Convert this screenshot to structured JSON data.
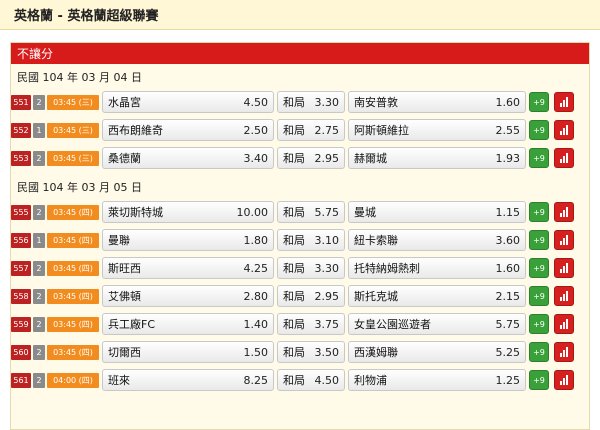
{
  "header": {
    "title": "英格蘭 - 英格蘭超級聯賽"
  },
  "panel": {
    "title": "不讓分"
  },
  "draw_label": "和局",
  "icons": {
    "stats": "bar-chart-icon"
  },
  "colors": {
    "match_no": "#bd2222",
    "time": "#f28c1e",
    "plus": "#3aa13a",
    "stats": "#d62020",
    "panel_head": "#d71a1a"
  },
  "groups": [
    {
      "date": "民國 104 年 03 月 04 日",
      "matches": [
        {
          "no": "551",
          "ch": "2",
          "time": "03:45 (三)",
          "home": "水晶宮",
          "home_odds": "4.50",
          "draw_odds": "3.30",
          "away": "南安普敦",
          "away_odds": "1.60",
          "more": "+9"
        },
        {
          "no": "552",
          "ch": "1",
          "time": "03:45 (三)",
          "home": "西布朗維奇",
          "home_odds": "2.50",
          "draw_odds": "2.75",
          "away": "阿斯頓維拉",
          "away_odds": "2.55",
          "more": "+9"
        },
        {
          "no": "553",
          "ch": "2",
          "time": "03:45 (三)",
          "home": "桑德蘭",
          "home_odds": "3.40",
          "draw_odds": "2.95",
          "away": "赫爾城",
          "away_odds": "1.93",
          "more": "+9"
        }
      ]
    },
    {
      "date": "民國 104 年 03 月 05 日",
      "matches": [
        {
          "no": "555",
          "ch": "2",
          "time": "03:45 (四)",
          "home": "萊切斯特城",
          "home_odds": "10.00",
          "draw_odds": "5.75",
          "away": "曼城",
          "away_odds": "1.15",
          "more": "+9"
        },
        {
          "no": "556",
          "ch": "1",
          "time": "03:45 (四)",
          "home": "曼聯",
          "home_odds": "1.80",
          "draw_odds": "3.10",
          "away": "紐卡索聯",
          "away_odds": "3.60",
          "more": "+9"
        },
        {
          "no": "557",
          "ch": "2",
          "time": "03:45 (四)",
          "home": "斯旺西",
          "home_odds": "4.25",
          "draw_odds": "3.30",
          "away": "托特納姆熱刺",
          "away_odds": "1.60",
          "more": "+9"
        },
        {
          "no": "558",
          "ch": "2",
          "time": "03:45 (四)",
          "home": "艾佛頓",
          "home_odds": "2.80",
          "draw_odds": "2.95",
          "away": "斯托克城",
          "away_odds": "2.15",
          "more": "+9"
        },
        {
          "no": "559",
          "ch": "2",
          "time": "03:45 (四)",
          "home": "兵工廠FC",
          "home_odds": "1.40",
          "draw_odds": "3.75",
          "away": "女皇公園巡遊者",
          "away_odds": "5.75",
          "more": "+9"
        },
        {
          "no": "560",
          "ch": "2",
          "time": "03:45 (四)",
          "home": "切爾西",
          "home_odds": "1.50",
          "draw_odds": "3.50",
          "away": "西漢姆聯",
          "away_odds": "5.25",
          "more": "+9"
        },
        {
          "no": "561",
          "ch": "2",
          "time": "04:00 (四)",
          "home": "班來",
          "home_odds": "8.25",
          "draw_odds": "4.50",
          "away": "利物浦",
          "away_odds": "1.25",
          "more": "+9"
        }
      ]
    }
  ]
}
